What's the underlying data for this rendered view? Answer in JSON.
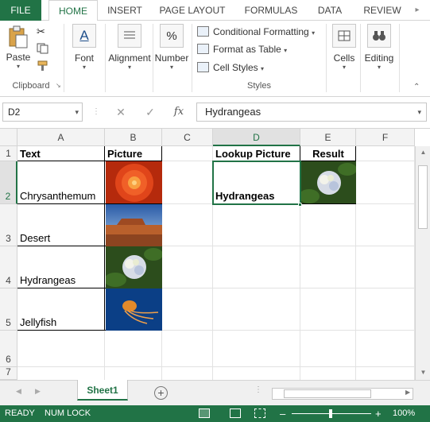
{
  "tabs": [
    "FILE",
    "HOME",
    "INSERT",
    "PAGE LAYOUT",
    "FORMULAS",
    "DATA",
    "REVIEW"
  ],
  "active_tab": "HOME",
  "ribbon": {
    "paste_label": "Paste",
    "clipboard_label": "Clipboard",
    "font_label": "Font",
    "alignment_label": "Alignment",
    "number_label": "Number",
    "conditional_formatting": "Conditional Formatting",
    "format_as_table": "Format as Table",
    "cell_styles": "Cell Styles",
    "styles_label": "Styles",
    "cells_label": "Cells",
    "editing_label": "Editing"
  },
  "formula_bar": {
    "name_box": "D2",
    "fx": "fx",
    "content": "Hydrangeas"
  },
  "grid": {
    "columns": [
      "A",
      "B",
      "C",
      "D",
      "E",
      "F"
    ],
    "rows": [
      "1",
      "2",
      "3",
      "4",
      "5",
      "6",
      "7"
    ],
    "selected_column": "D",
    "selected_row": "2",
    "cells": {
      "a1": "Text",
      "b1": "Picture",
      "d1": "Lookup Picture",
      "e1": "Result",
      "a2": "Chrysanthemum",
      "a3": "Desert",
      "a4": "Hydrangeas",
      "a5": "Jellyfish",
      "d2": "Hydrangeas"
    },
    "pictures": [
      "chrysanthemum-image",
      "desert-image",
      "hydrangeas-image",
      "jellyfish-image"
    ]
  },
  "sheet_tabs": [
    "Sheet1"
  ],
  "status": {
    "ready": "READY",
    "num_lock": "NUM LOCK",
    "zoom": "100%"
  },
  "colors": {
    "accent": "#217346"
  }
}
